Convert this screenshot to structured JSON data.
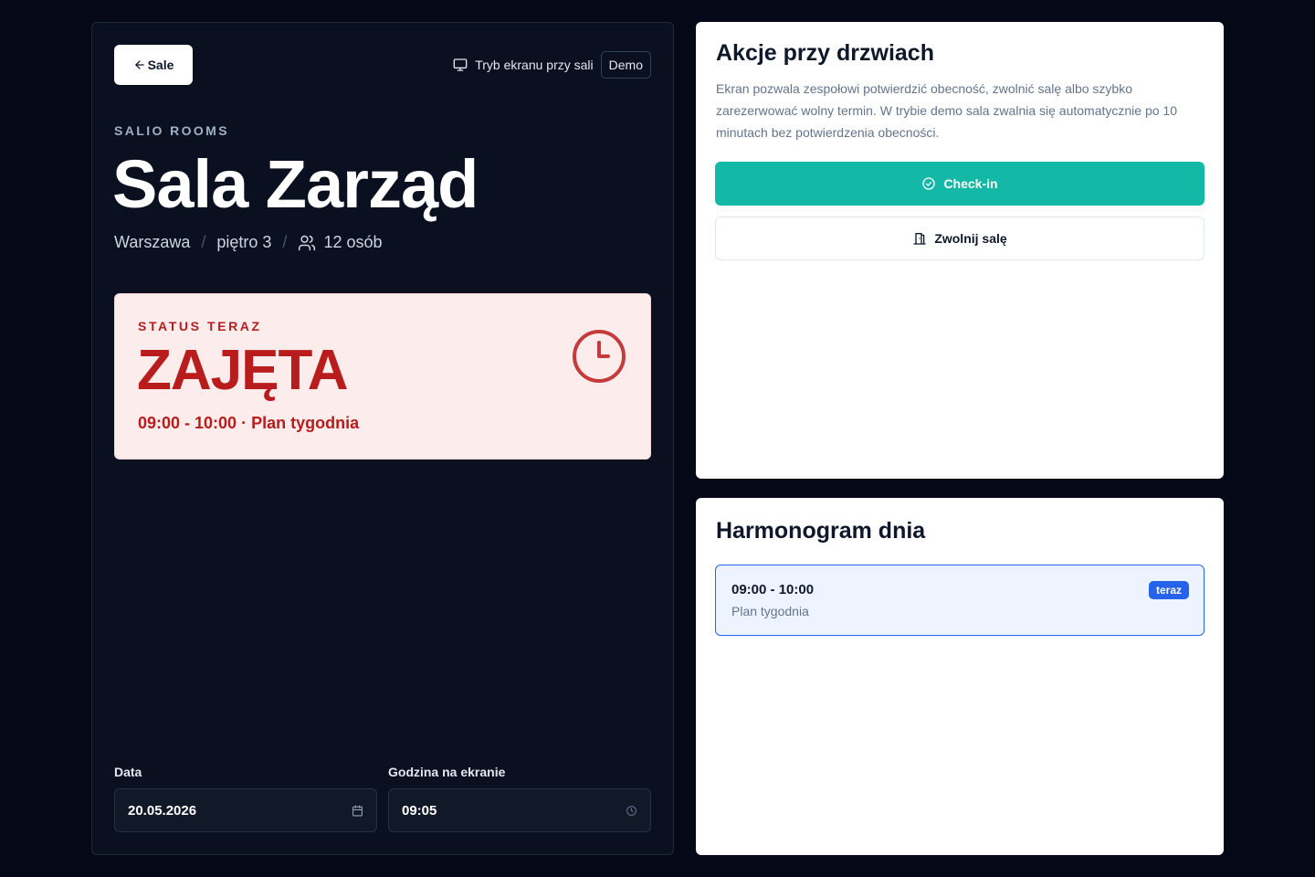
{
  "left": {
    "back_label": "Sale",
    "screen_mode_label": "Tryb ekranu przy sali",
    "demo_badge": "Demo",
    "brand": "SALIO ROOMS",
    "room_name": "Sala Zarząd",
    "city": "Warszawa",
    "floor": "piętro 3",
    "capacity": "12 osób",
    "status": {
      "label": "STATUS TERAZ",
      "value": "ZAJĘTA",
      "detail": "09:00 - 10:00 · Plan tygodnia",
      "color": "#b91c1c",
      "background": "#fdecec"
    },
    "date_label": "Data",
    "date_value": "20.05.2026",
    "time_label": "Godzina na ekranie",
    "time_value": "09:05"
  },
  "actions": {
    "title": "Akcje przy drzwiach",
    "description": "Ekran pozwala zespołowi potwierdzić obecność, zwolnić salę albo szybko zarezerwować wolny termin. W trybie demo sala zwalnia się automatycznie po 10 minutach bez potwierdzenia obecności.",
    "checkin_label": "Check-in",
    "release_label": "Zwolnij salę",
    "accent": "#14b8a6"
  },
  "schedule": {
    "title": "Harmonogram dnia",
    "items": [
      {
        "time": "09:00 - 10:00",
        "title": "Plan tygodnia",
        "badge": "teraz"
      }
    ]
  },
  "icons": {
    "back": "arrow-left-icon",
    "screen": "monitor-icon",
    "people": "users-icon",
    "status": "clock-icon",
    "calendar": "calendar-icon",
    "time": "clock-small-icon",
    "checkin": "check-circle-icon",
    "release": "door-icon"
  }
}
